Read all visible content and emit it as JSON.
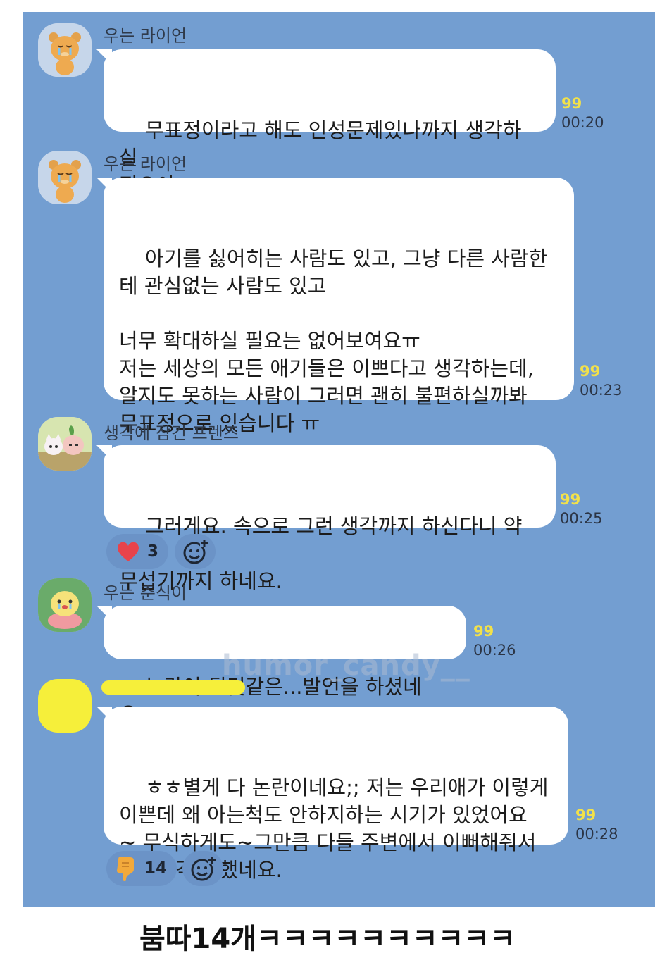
{
  "messages": [
    {
      "sender": "우는 라이언",
      "avatar_icon": "crying-lion-icon",
      "text": "무표정이라고 해도 인성문제있나까지 생각하실\n필요야...",
      "unread": "99",
      "time": "00:20"
    },
    {
      "sender": "우는 라이언",
      "avatar_icon": "crying-lion-icon",
      "text": "아기를 싫어히는 사람도 있고, 그냥 다른 사람한\n테 관심없는 사람도 있고\n\n너무 확대하실 필요는 없어보여요ㅠ\n저는 세상의 모든 애기들은 이쁘다고 생각하는데,\n알지도 못하는 사람이 그러면 괜히 불편하실까봐\n무표정으로 있습니다 ㅠ",
      "unread": "99",
      "time": "00:23"
    },
    {
      "sender": "생각에 잠긴 프렌즈",
      "avatar_icon": "thinking-friends-icon",
      "text": "그러게요. 속으로 그런 생각까지 하신다니 약간\n무섭기까지 하네요.",
      "unread": "99",
      "time": "00:25",
      "reaction": {
        "icon": "heart-icon",
        "count": "3"
      }
    },
    {
      "sender": "우는 춘식이",
      "avatar_icon": "crying-choonsik-icon",
      "text": "논란이 될것같은...발언을 하셨네요...",
      "unread": "99",
      "time": "00:26"
    },
    {
      "sender": "",
      "avatar_icon": "hidden-avatar-icon",
      "text": "ㅎㅎ별게 다 논란이네요;; 저는 우리애가 이렇게\n이쁜데 왜 아는척도 안하지하는 시기가 있었어요\n~ 무식하게도~그만큼 다들 주변에서 이뻐해줘서\n그런착각도 했네요.",
      "unread": "99",
      "time": "00:28",
      "reaction": {
        "icon": "thumbs-down-icon",
        "count": "14"
      }
    }
  ],
  "add_reaction_icon": "add-emoji-icon",
  "watermark": "humor_candy__",
  "caption": "붐따14개ㅋㅋㅋㅋㅋㅋㅋㅋㅋㅋ",
  "colors": {
    "chat_background": "#739ed1",
    "bubble": "#ffffff",
    "unread": "#f2e14a",
    "reaction_pill": "#6b93c7",
    "heart": "#e8434b",
    "thumbs_down": "#f2a93b",
    "name_highlight": "#f6ef3a"
  }
}
